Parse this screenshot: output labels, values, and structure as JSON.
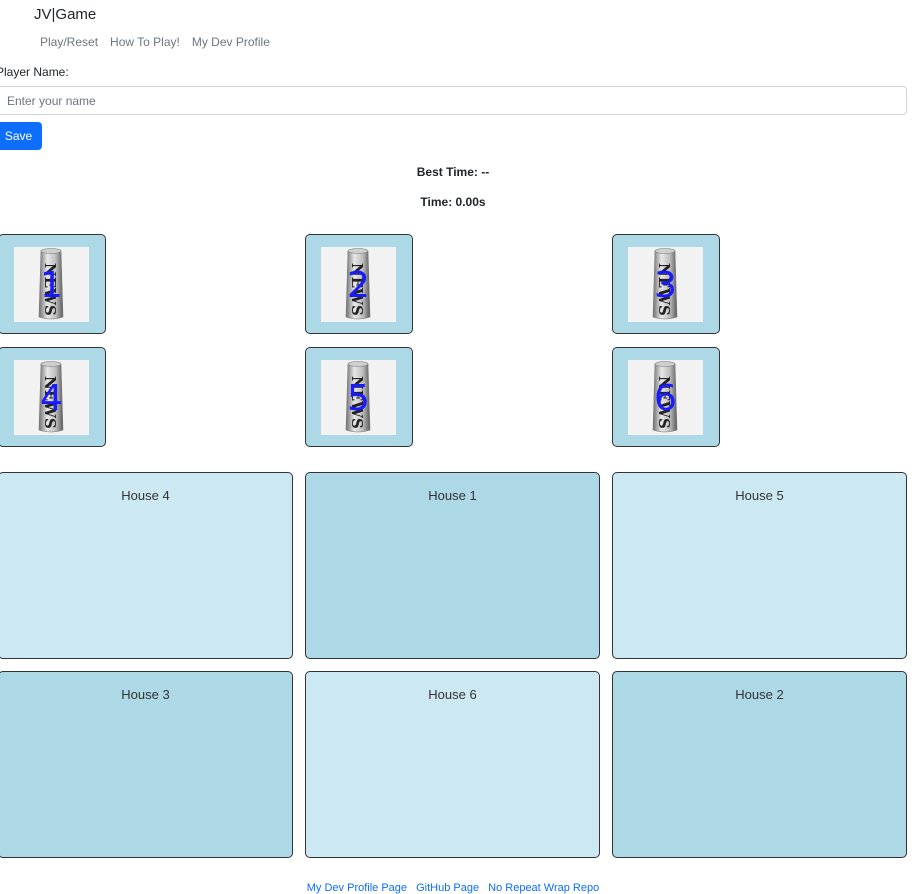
{
  "header": {
    "brand": "JV|Game",
    "nav": [
      "Play/Reset",
      "How To Play!",
      "My Dev Profile"
    ]
  },
  "player": {
    "label": "Player Name:",
    "placeholder": "Enter your name",
    "value": "",
    "save_label": "Save"
  },
  "stats": {
    "best_time": "Best Time: --",
    "time": "Time: 0.00s"
  },
  "papers": [
    {
      "number": "1",
      "icon": "newspaper-icon"
    },
    {
      "number": "2",
      "icon": "newspaper-icon"
    },
    {
      "number": "3",
      "icon": "newspaper-icon"
    },
    {
      "number": "4",
      "icon": "newspaper-icon"
    },
    {
      "number": "5",
      "icon": "newspaper-icon"
    },
    {
      "number": "6",
      "icon": "newspaper-icon"
    }
  ],
  "houses": [
    {
      "label": "House 4",
      "shade": "light"
    },
    {
      "label": "House 1",
      "shade": "dark"
    },
    {
      "label": "House 5",
      "shade": "light"
    },
    {
      "label": "House 3",
      "shade": "dark"
    },
    {
      "label": "House 6",
      "shade": "light"
    },
    {
      "label": "House 2",
      "shade": "dark"
    }
  ],
  "footer": {
    "links": [
      "My Dev Profile Page",
      "GitHub Page",
      "No Repeat Wrap Repo"
    ]
  },
  "colors": {
    "accent": "#0d6efd",
    "paper_bg": "#add8e6",
    "house_light": "#cce8f3",
    "house_dark": "#add8e6",
    "paper_number": "#1a1aff"
  }
}
